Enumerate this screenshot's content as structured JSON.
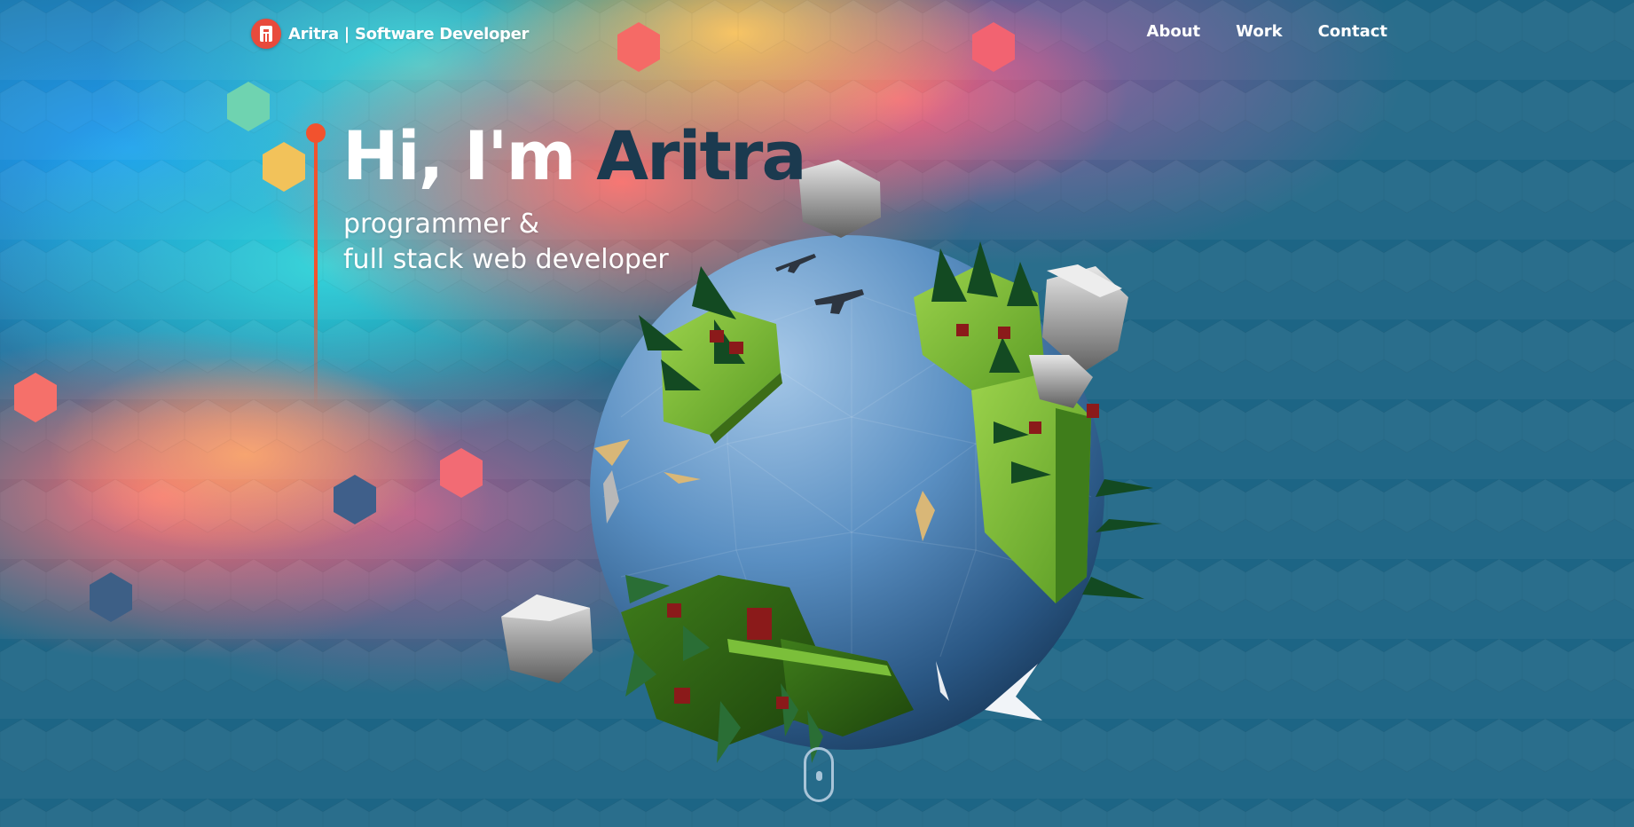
{
  "header": {
    "brand_title": "Aritra | Software Developer",
    "logo_letter": "A",
    "nav": [
      {
        "label": "About"
      },
      {
        "label": "Work"
      },
      {
        "label": "Contact"
      }
    ]
  },
  "hero": {
    "greeting": "Hi, I'm ",
    "name": "Aritra",
    "subtitle_line1": "programmer &",
    "subtitle_line2": "full stack web developer"
  },
  "icons": {
    "logo": "brand-logo-icon",
    "scroll": "mouse-scroll-icon"
  },
  "colors": {
    "background": "#1d6585",
    "accent": "#f2522e",
    "name_text": "#1b3a4f",
    "planet_ocean": "#5b8fc4",
    "planet_land": "#7bbf3a",
    "trees": "#1a5a2a"
  }
}
